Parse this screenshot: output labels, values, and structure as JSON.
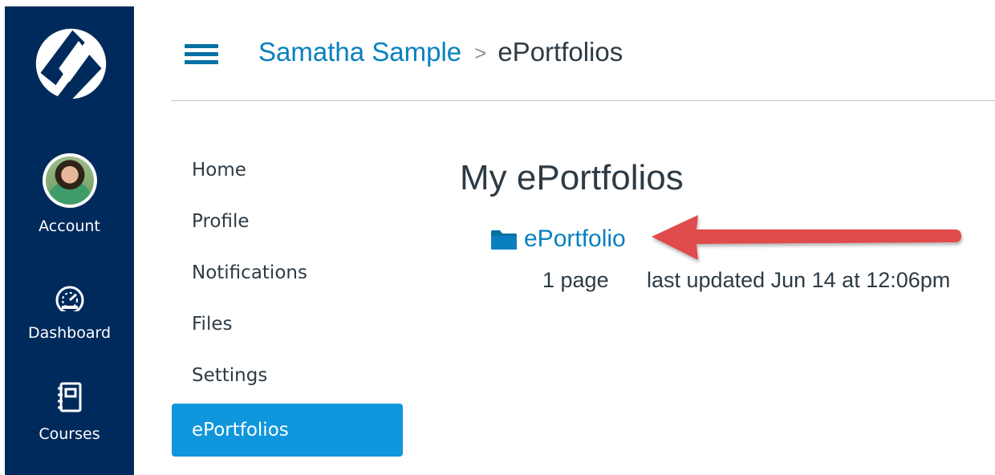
{
  "global_nav": {
    "account_label": "Account",
    "dashboard_label": "Dashboard",
    "courses_label": "Courses"
  },
  "breadcrumb": {
    "user": "Samatha Sample",
    "separator": ">",
    "current": "ePortfolios"
  },
  "section_nav": {
    "items": [
      {
        "label": "Home"
      },
      {
        "label": "Profile"
      },
      {
        "label": "Notifications"
      },
      {
        "label": "Files"
      },
      {
        "label": "Settings"
      },
      {
        "label": "ePortfolios"
      }
    ],
    "active": "ePortfolios"
  },
  "content": {
    "title": "My ePortfolios",
    "portfolio": {
      "name": "ePortfolio",
      "pages": "1 page",
      "updated": "last updated Jun 14 at 12:06pm"
    }
  },
  "colors": {
    "nav_bg": "#002a5c",
    "link": "#0880c0",
    "active_item": "#0f96dc",
    "annotation_arrow": "#e04b4b"
  },
  "icons": [
    "canvas-logo-icon",
    "hamburger-menu-icon",
    "dashboard-gauge-icon",
    "courses-notebook-icon",
    "folder-icon",
    "red-pointer-arrow"
  ]
}
